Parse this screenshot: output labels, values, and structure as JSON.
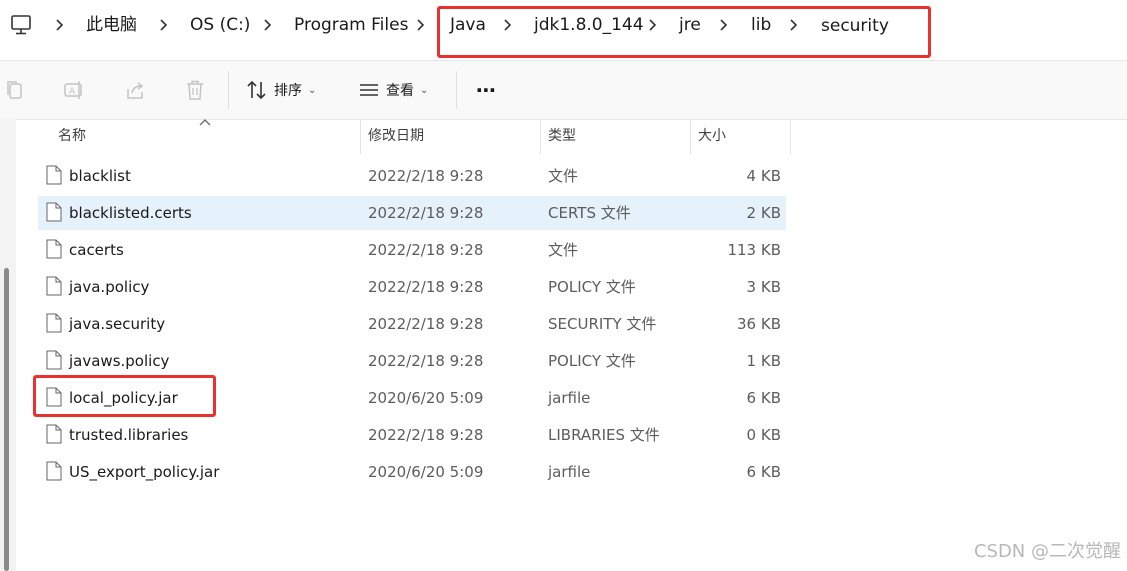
{
  "breadcrumb": {
    "items": [
      {
        "label": "此电脑"
      },
      {
        "label": "OS (C:)"
      },
      {
        "label": "Program Files"
      },
      {
        "label": "Java"
      },
      {
        "label": "jdk1.8.0_144"
      },
      {
        "label": "jre"
      },
      {
        "label": "lib"
      },
      {
        "label": "security"
      }
    ]
  },
  "toolbar": {
    "sort_label": "排序",
    "view_label": "查看",
    "more_label": "⋯"
  },
  "columns": {
    "name": "名称",
    "date": "修改日期",
    "type": "类型",
    "size": "大小"
  },
  "files": [
    {
      "name": "blacklist",
      "date": "2022/2/18 9:28",
      "type": "文件",
      "size": "4 KB"
    },
    {
      "name": "blacklisted.certs",
      "date": "2022/2/18 9:28",
      "type": "CERTS 文件",
      "size": "2 KB"
    },
    {
      "name": "cacerts",
      "date": "2022/2/18 9:28",
      "type": "文件",
      "size": "113 KB"
    },
    {
      "name": "java.policy",
      "date": "2022/2/18 9:28",
      "type": "POLICY 文件",
      "size": "3 KB"
    },
    {
      "name": "java.security",
      "date": "2022/2/18 9:28",
      "type": "SECURITY 文件",
      "size": "36 KB"
    },
    {
      "name": "javaws.policy",
      "date": "2022/2/18 9:28",
      "type": "POLICY 文件",
      "size": "1 KB"
    },
    {
      "name": "local_policy.jar",
      "date": "2020/6/20 5:09",
      "type": "jarfile",
      "size": "6 KB"
    },
    {
      "name": "trusted.libraries",
      "date": "2022/2/18 9:28",
      "type": "LIBRARIES 文件",
      "size": "0 KB"
    },
    {
      "name": "US_export_policy.jar",
      "date": "2020/6/20 5:09",
      "type": "jarfile",
      "size": "6 KB"
    }
  ],
  "watermark": "CSDN @二次觉醒",
  "colors": {
    "highlight": "#e8322f",
    "selected_row": "#e5f1fb"
  },
  "icons": [
    "computer-icon",
    "copy-icon",
    "rename-icon",
    "share-icon",
    "delete-icon",
    "sort-icon",
    "view-icon",
    "file-icon"
  ]
}
